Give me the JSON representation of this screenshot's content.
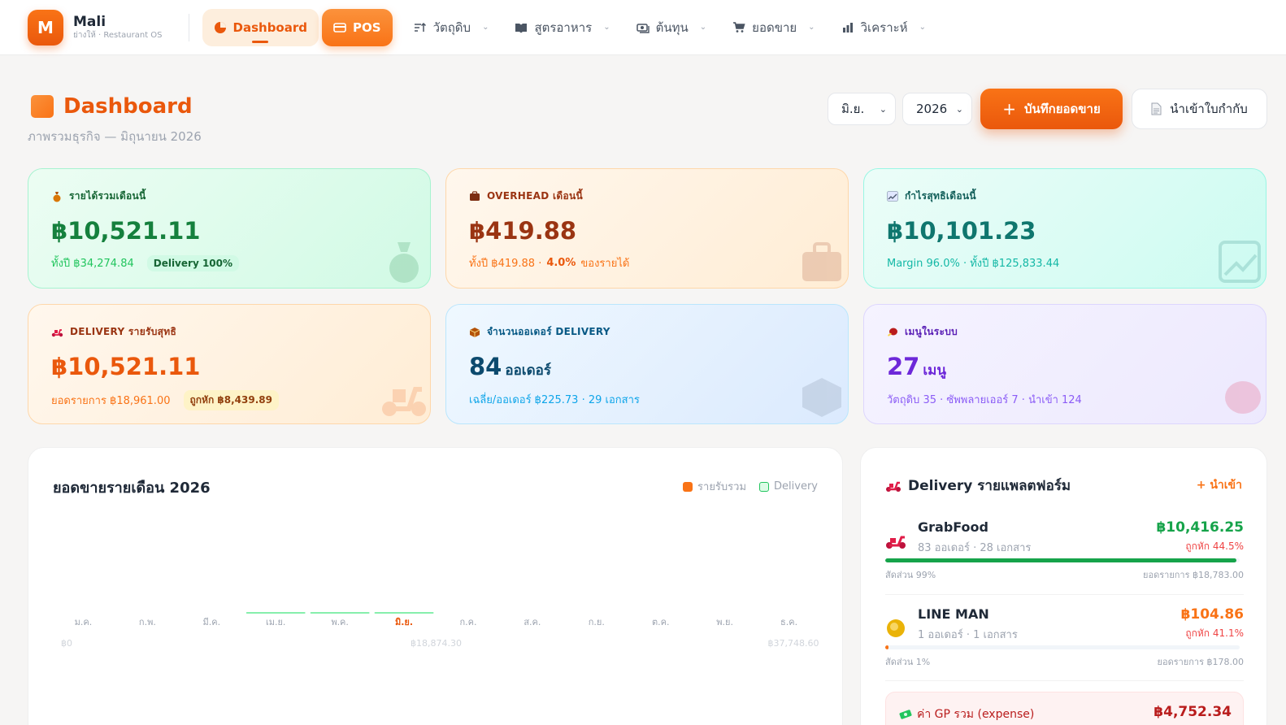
{
  "brand": {
    "logo_letter": "M",
    "name": "Mali",
    "subtitle": "ย่างให้ · Restaurant OS"
  },
  "nav": {
    "dashboard": "Dashboard",
    "pos": "POS",
    "ingredients": "วัตถุดิบ",
    "recipes": "สูตรอาหาร",
    "cost": "ต้นทุน",
    "sales": "ยอดขาย",
    "analytics": "วิเคราะห์"
  },
  "header": {
    "title": "Dashboard",
    "subtitle": "ภาพรวมธุรกิจ — มิถุนายน 2026",
    "month_select": "มิ.ย.",
    "year_select": "2026",
    "record_sales_button": "บันทึกยอดขาย",
    "import_invoice_button": "นำเข้าใบกำกับ"
  },
  "kpis": {
    "revenue": {
      "label": "รายได้รวมเดือนนี้",
      "value": "฿10,521.11",
      "foot": "ทั้งปี ฿34,274.84",
      "pill": "Delivery 100%"
    },
    "overhead": {
      "label": "OVERHEAD เดือนนี้",
      "value": "฿419.88",
      "foot_a": "ทั้งปี ฿419.88 ·",
      "foot_pct": "4.0%",
      "foot_b": "ของรายได้"
    },
    "profit": {
      "label": "กำไรสุทธิเดือนนี้",
      "value": "฿10,101.23",
      "foot": "Margin 96.0% · ทั้งปี ฿125,833.44"
    },
    "delivery_net": {
      "label": "DELIVERY รายรับสุทธิ",
      "value": "฿10,521.11",
      "foot": "ยอดรายการ ฿18,961.00",
      "pill": "ถูกหัก ฿8,439.89"
    },
    "delivery_orders": {
      "label": "จำนวนออเดอร์ DELIVERY",
      "value": "84",
      "unit": "ออเดอร์",
      "foot": "เฉลี่ย/ออเดอร์ ฿225.73 · 29 เอกสาร"
    },
    "menus": {
      "label": "เมนูในระบบ",
      "value": "27",
      "unit": "เมนู",
      "foot": "วัตถุดิบ 35 · ซัพพลายเออร์ 7 · นำเข้า 124"
    }
  },
  "chart_data": {
    "type": "bar",
    "title": "ยอดขายรายเดือน 2026",
    "categories": [
      "ม.ค.",
      "ก.พ.",
      "มี.ค.",
      "เม.ย.",
      "พ.ค.",
      "มิ.ย.",
      "ก.ค.",
      "ส.ค.",
      "ก.ย.",
      "ต.ค.",
      "พ.ย.",
      "ธ.ค."
    ],
    "highlight_category": "มิ.ย.",
    "series": [
      {
        "name": "รายรับรวม",
        "color": "#f97316",
        "values": [
          0,
          0,
          0,
          0,
          0,
          0,
          0,
          0,
          0,
          0,
          0,
          0
        ]
      },
      {
        "name": "Delivery",
        "color": "#86efac",
        "values": [
          0,
          0,
          0,
          1,
          1,
          1,
          0,
          0,
          0,
          0,
          0,
          0
        ]
      }
    ],
    "axis_labels": [
      "฿0",
      "฿18,874.30",
      "฿37,748.60"
    ],
    "ylim": [
      0,
      37748.6
    ],
    "legend": "top-right"
  },
  "delivery": {
    "title": "Delivery รายแพลตฟอร์ม",
    "add_link": "+ นำเข้า",
    "platforms": [
      {
        "name": "GrabFood",
        "meta": "83 ออเดอร์ · 28 เอกสาร",
        "amount": "฿10,416.25",
        "fee": "ถูกหัก 44.5%",
        "share_label": "สัดส่วน 99%",
        "share": 0.99,
        "gross": "ยอดรายการ ฿18,783.00",
        "color": "#16a34a",
        "amount_color": "#16a34a"
      },
      {
        "name": "LINE MAN",
        "meta": "1 ออเดอร์ · 1 เอกสาร",
        "amount": "฿104.86",
        "fee": "ถูกหัก 41.1%",
        "share_label": "สัดส่วน 1%",
        "share": 0.01,
        "gross": "ยอดรายการ ฿178.00",
        "color": "#f97316",
        "amount_color": "#f97316"
      }
    ],
    "gp_label": "ค่า GP รวม (expense)",
    "gp_amount": "฿4,752.34"
  }
}
